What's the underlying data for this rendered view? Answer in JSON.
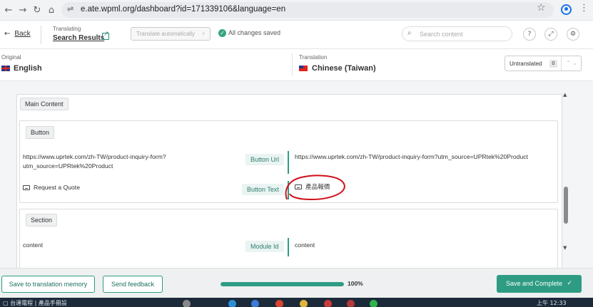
{
  "browser": {
    "url": "e.ate.wpml.org/dashboard?id=171339106&language=en",
    "nav_back": "←",
    "nav_forward": "→",
    "nav_reload": "↻",
    "nav_home": "⌂",
    "site_icon": "⇌",
    "bookmark": "☆",
    "menu": "⋮"
  },
  "topbar": {
    "back_label": "Back",
    "translating_caption": "Translating",
    "translating_title": "Search Results",
    "auto_translate_label": "Translate automatically",
    "saved_status": "All changes saved",
    "search_placeholder": "Search content",
    "help_icon": "?",
    "expand_icon": "⤢",
    "settings_icon": "⚙"
  },
  "languages": {
    "original_caption": "Original",
    "original_name": "English",
    "translation_caption": "Translation",
    "translation_name": "Chinese (Taiwan)",
    "untranslated_label": "Untranslated",
    "untranslated_count": "0",
    "nav_arrows": "⌃ ⌄"
  },
  "content": {
    "main_section": "Main Content",
    "button_section": "Button",
    "section_section": "Section",
    "rows": [
      {
        "field": "Button Url",
        "original_line1": "https://www.uprtek.com/zh-TW/product-inquiry-form?",
        "original_line2": "utm_source=UPRtek%20Product",
        "translation": "https://www.uprtek.com/zh-TW/product-inquiry-form?utm_source=UPRtek%20Product"
      },
      {
        "field": "Button Text",
        "original": "Request a Quote",
        "translation": "產品報價"
      },
      {
        "field": "Module Id",
        "original": "content",
        "translation": "content"
      }
    ]
  },
  "footer": {
    "save_memory_label": "Save to translation memory",
    "send_feedback_label": "Send feedback",
    "progress_percent": 100,
    "progress_label": "100%",
    "complete_label": "Save and Complete",
    "complete_icon": "✓"
  },
  "taskbar": {
    "left_text": "▢ 台達電程 | 產品手冊設",
    "clock": "上午 12:33"
  },
  "colors": {
    "accent": "#2e9c83",
    "annotation": "#d0101a"
  }
}
